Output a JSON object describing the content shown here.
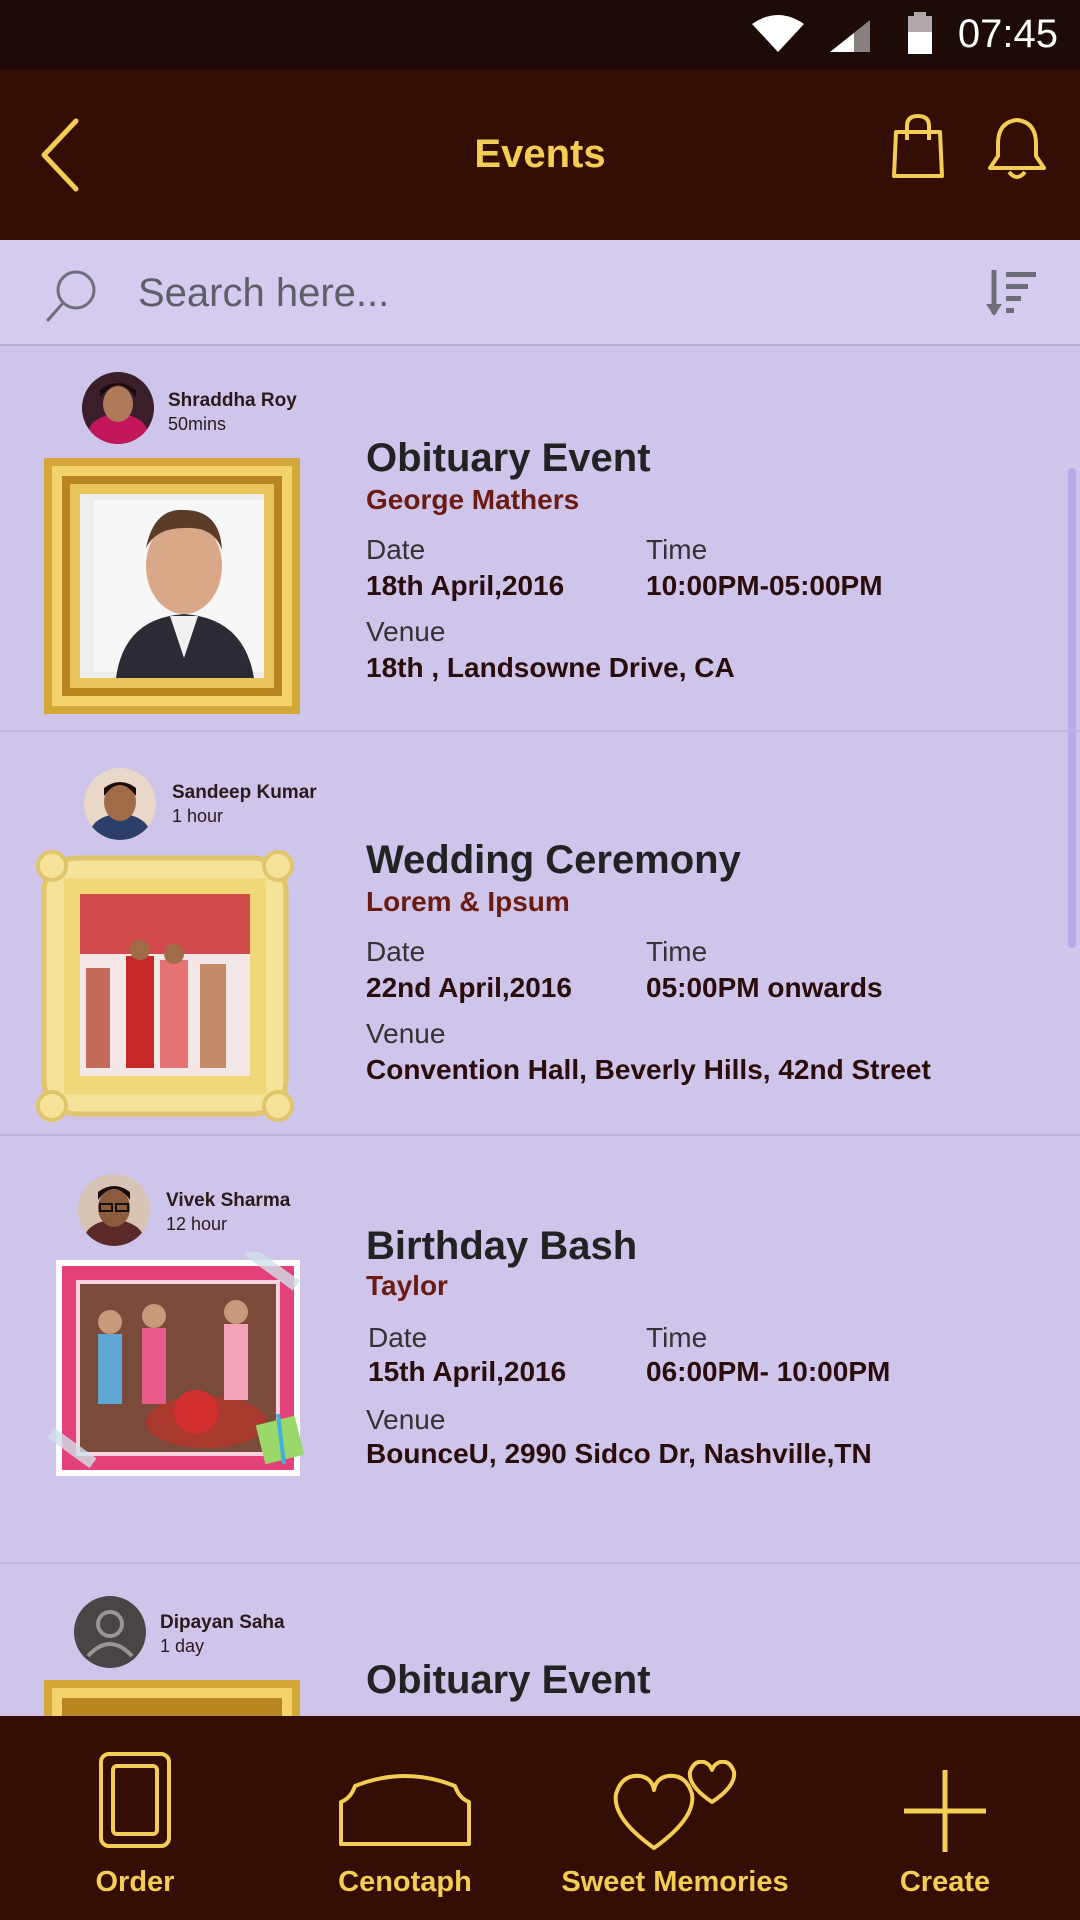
{
  "status_bar": {
    "time": "07:45"
  },
  "header": {
    "title": "Events"
  },
  "search": {
    "placeholder": "Search here..."
  },
  "events": [
    {
      "user": "Shraddha Roy",
      "ago": "50mins",
      "title": "Obituary Event",
      "subtitle": "George Mathers",
      "date_label": "Date",
      "date": "18th April,2016",
      "time_label": "Time",
      "time": "10:00PM-05:00PM",
      "venue_label": "Venue",
      "venue": "18th , Landsowne Drive, CA"
    },
    {
      "user": "Sandeep Kumar",
      "ago": "1 hour",
      "title": "Wedding Ceremony",
      "subtitle": "Lorem & Ipsum",
      "date_label": "Date",
      "date": "22nd April,2016",
      "time_label": "Time",
      "time": "05:00PM onwards",
      "venue_label": "Venue",
      "venue": "Convention Hall, Beverly Hills, 42nd Street"
    },
    {
      "user": "Vivek Sharma",
      "ago": "12 hour",
      "title": "Birthday Bash",
      "subtitle": "Taylor",
      "date_label": "Date",
      "date": "15th April,2016",
      "time_label": "Time",
      "time": "06:00PM- 10:00PM",
      "venue_label": "Venue",
      "venue": "BounceU, 2990 Sidco Dr, Nashville,TN"
    },
    {
      "user": "Dipayan Saha",
      "ago": "1 day",
      "title": "Obituary Event"
    }
  ],
  "nav": [
    {
      "label": "Order"
    },
    {
      "label": "Cenotaph"
    },
    {
      "label": "Sweet Memories"
    },
    {
      "label": "Create"
    }
  ],
  "colors": {
    "accent": "#f4cd54",
    "bar": "#340e05",
    "background": "#cfc4ea",
    "subtitle": "#6b1b12"
  }
}
